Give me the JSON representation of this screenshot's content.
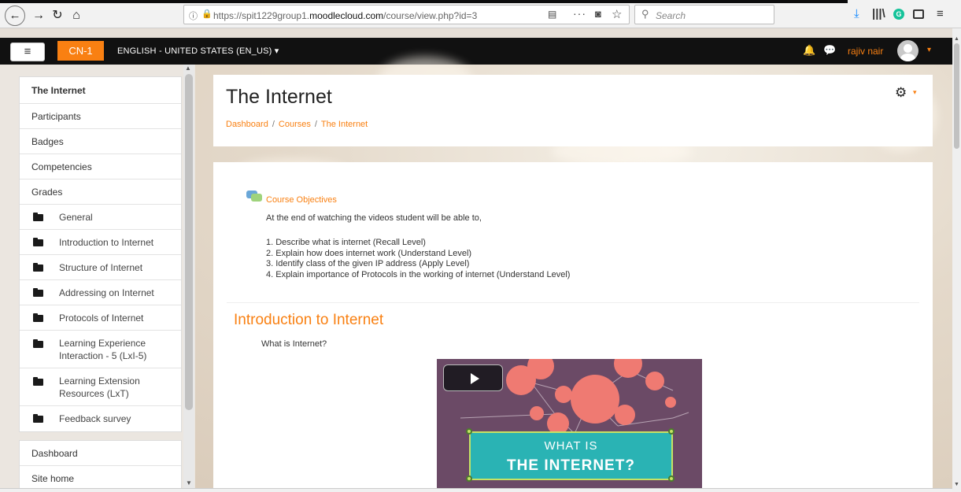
{
  "browser": {
    "url_prefix": "https://spit1229group1.",
    "url_domain": "moodlecloud.com",
    "url_path": "/course/view.php?id=3",
    "search_placeholder": "Search",
    "back_glyph": "←",
    "forward_glyph": "→",
    "reload_glyph": "↻",
    "home_glyph": "⌂"
  },
  "navbar": {
    "drawer_toggle": "≡",
    "course_short_name": "CN-1",
    "language": "ENGLISH - UNITED STATES (EN_US) ▾",
    "user_name": "rajiv nair",
    "user_caret": "▾"
  },
  "drawer": {
    "items": [
      {
        "label": "The Internet"
      },
      {
        "label": "Participants"
      },
      {
        "label": "Badges"
      },
      {
        "label": "Competencies"
      },
      {
        "label": "Grades"
      }
    ],
    "sections": [
      {
        "label": "General"
      },
      {
        "label": "Introduction to Internet"
      },
      {
        "label": "Structure of Internet"
      },
      {
        "label": "Addressing on Internet"
      },
      {
        "label": "Protocols of Internet"
      },
      {
        "label_line1": "Learning Experience",
        "label_line2": "Interaction - 5 (LxI-5)"
      },
      {
        "label_line1": "Learning Extension",
        "label_line2": "Resources (LxT)"
      },
      {
        "label": "Feedback survey"
      }
    ],
    "bottom_items": [
      {
        "label": "Dashboard"
      },
      {
        "label": "Site home"
      }
    ]
  },
  "header": {
    "title": "The Internet",
    "breadcrumb": [
      "Dashboard",
      "Courses",
      "The Internet"
    ],
    "breadcrumb_sep": "/"
  },
  "content": {
    "objectives_link": "Course Objectives",
    "intro": "At the end of watching the videos student will be able to,",
    "objectives": [
      "1. Describe what is internet (Recall Level)",
      "2. Explain how does internet work (Understand Level)",
      "3. Identify class of the given IP address (Apply Level)",
      "4. Explain importance of Protocols in the working of internet (Understand Level)"
    ],
    "section_title": "Introduction to Internet",
    "question": "What is Internet?",
    "video_line1": "WHAT IS",
    "video_line2": "THE INTERNET?"
  },
  "colors": {
    "accent": "#f98012",
    "navbar_bg": "#111111",
    "video_banner": "#2ab3b4"
  }
}
